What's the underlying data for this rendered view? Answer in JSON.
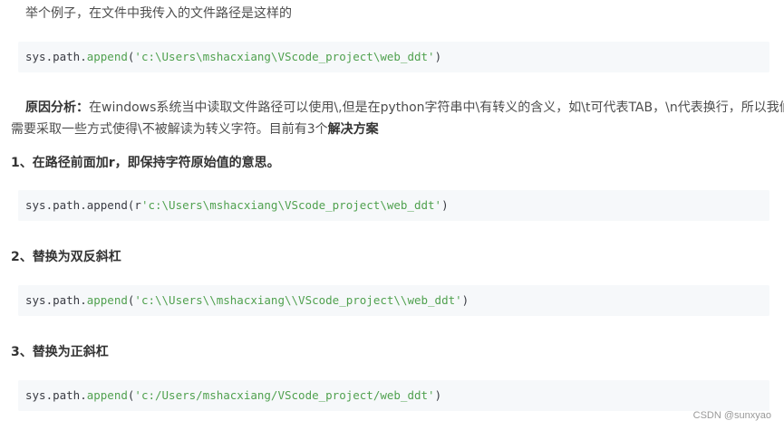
{
  "intro": "举个例子，在文件中我传入的文件路径是这样的",
  "code1": {
    "pre": "sys.path.",
    "fn": "append",
    "open": "(",
    "str": "'c:\\Users\\mshacxiang\\VScode_project\\web_ddt'",
    "close": ")"
  },
  "analysis": {
    "label": "原因分析：",
    "line1": "在windows系统当中读取文件路径可以使用\\,但是在python字符串中\\有转义的含义，如\\t可代表TAB，\\n代表换行，所以我们",
    "line2": "需要采取一些方式使得\\不被解读为转义字符。目前有3个",
    "line2_bold": "解决方案"
  },
  "section1": {
    "title": "1、在路径前面加r，即保持字符原始值的意思。"
  },
  "code2": {
    "pre": "sys.path.append(r",
    "str": "'c:\\Users\\mshacxiang\\VScode_project\\web_ddt'",
    "close": ")"
  },
  "section2": {
    "title": "2、替换为双反斜杠"
  },
  "code3": {
    "pre": "sys.path.",
    "fn": "append",
    "open": "(",
    "str": "'c:\\\\Users\\\\mshacxiang\\\\VScode_project\\\\web_ddt'",
    "close": ")"
  },
  "section3": {
    "title": "3、替换为正斜杠"
  },
  "code4": {
    "pre": "sys.path.",
    "fn": "append",
    "open": "(",
    "str": "'c:/Users/mshacxiang/VScode_project/web_ddt'",
    "close": ")"
  },
  "watermark": "CSDN @sunxyao",
  "colors": {
    "code_bg": "#f6f8fa",
    "string": "#50a14f",
    "text": "#4d4d4d"
  }
}
